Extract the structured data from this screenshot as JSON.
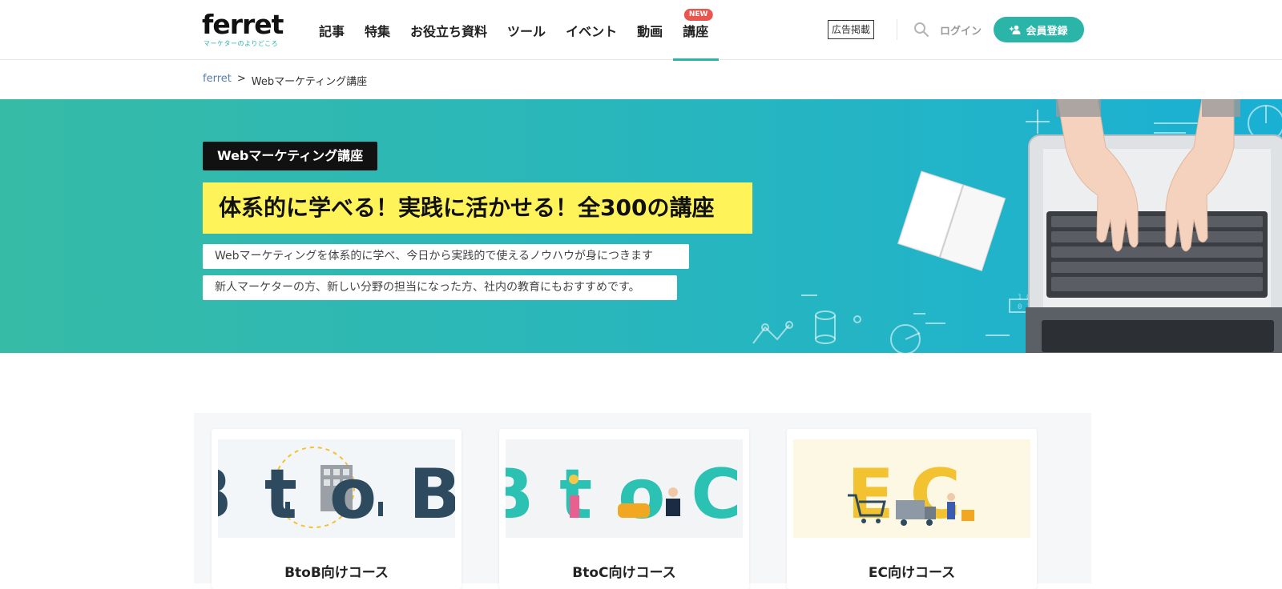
{
  "header": {
    "logo_text": "ferret",
    "logo_tagline": "マーケターのよりどころ",
    "nav": [
      {
        "label": "記事"
      },
      {
        "label": "特集"
      },
      {
        "label": "お役立ち資料"
      },
      {
        "label": "ツール"
      },
      {
        "label": "イベント"
      },
      {
        "label": "動画"
      },
      {
        "label": "講座",
        "badge": "NEW"
      }
    ],
    "ad_link": "広告掲載",
    "search_icon": "search-icon",
    "login": "ログイン",
    "register": "会員登録",
    "accent_color": "#2bb5a8"
  },
  "breadcrumb": {
    "home": "ferret",
    "separator": ">",
    "current": "Webマーケティング講座"
  },
  "hero": {
    "badge": "Webマーケティング講座",
    "title": "体系的に学べる！実践に活かせる！全300の講座",
    "subtitle1": "Webマーケティングを体系的に学べ、今日から実践的で使えるノウハウが身につきます",
    "subtitle2": "新人マーケターの方、新しい分野の担当になった方、社内の教育にもおすすめです。",
    "highlight_color": "#fff35a"
  },
  "courses": [
    {
      "title": "BtoB向けコース",
      "image_text": "BtoB",
      "image_text_sub": "to"
    },
    {
      "title": "BtoC向けコース",
      "image_text": "BtoC",
      "image_text_sub": "to"
    },
    {
      "title": "EC向けコース",
      "image_text": "EC"
    }
  ]
}
